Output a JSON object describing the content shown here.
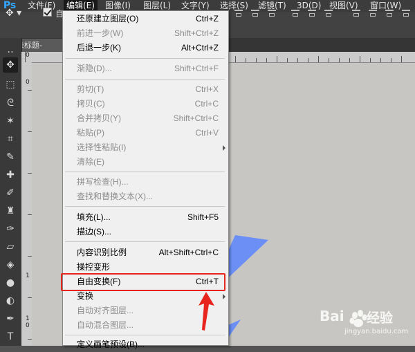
{
  "app": {
    "logo": "Ps"
  },
  "menubar": {
    "items": [
      "文件(F)",
      "编辑(E)",
      "图像(I)",
      "图层(L)",
      "文字(Y)",
      "选择(S)",
      "滤镜(T)",
      "3D(D)",
      "视图(V)",
      "窗口(W)"
    ],
    "active": "编辑(E)"
  },
  "options": {
    "auto_label": "自",
    "move_icon": "move-tool-icon"
  },
  "document": {
    "tab_title": "未标题-"
  },
  "rulers": {
    "top_zero": "0",
    "left_numbers": [
      "0",
      "1",
      "1",
      "0"
    ]
  },
  "edit_menu": {
    "items": [
      {
        "label": "还原建立图层(O)",
        "shortcut": "Ctrl+Z",
        "enabled": true
      },
      {
        "label": "前进一步(W)",
        "shortcut": "Shift+Ctrl+Z",
        "enabled": false
      },
      {
        "label": "后退一步(K)",
        "shortcut": "Alt+Ctrl+Z",
        "enabled": true
      },
      {
        "label": "渐隐(D)...",
        "shortcut": "Shift+Ctrl+F",
        "enabled": false
      },
      {
        "label": "剪切(T)",
        "shortcut": "Ctrl+X",
        "enabled": false
      },
      {
        "label": "拷贝(C)",
        "shortcut": "Ctrl+C",
        "enabled": false
      },
      {
        "label": "合并拷贝(Y)",
        "shortcut": "Shift+Ctrl+C",
        "enabled": false
      },
      {
        "label": "粘贴(P)",
        "shortcut": "Ctrl+V",
        "enabled": false
      },
      {
        "label": "选择性粘贴(I)",
        "shortcut": "",
        "enabled": false,
        "submenu": true
      },
      {
        "label": "清除(E)",
        "shortcut": "",
        "enabled": false
      },
      {
        "label": "拼写检查(H)...",
        "shortcut": "",
        "enabled": false
      },
      {
        "label": "查找和替换文本(X)...",
        "shortcut": "",
        "enabled": false
      },
      {
        "label": "填充(L)...",
        "shortcut": "Shift+F5",
        "enabled": true
      },
      {
        "label": "描边(S)...",
        "shortcut": "",
        "enabled": true
      },
      {
        "label": "内容识别比例",
        "shortcut": "Alt+Shift+Ctrl+C",
        "enabled": true
      },
      {
        "label": "操控变形",
        "shortcut": "",
        "enabled": true
      },
      {
        "label": "自由变换(F)",
        "shortcut": "Ctrl+T",
        "enabled": true,
        "highlighted": true
      },
      {
        "label": "变换",
        "shortcut": "",
        "enabled": true,
        "submenu": true
      },
      {
        "label": "自动对齐图层...",
        "shortcut": "",
        "enabled": false
      },
      {
        "label": "自动混合图层...",
        "shortcut": "",
        "enabled": false
      },
      {
        "label": "定义画笔预设(B)...",
        "shortcut": "",
        "enabled": true
      }
    ]
  },
  "watermark": {
    "brand": "Bai",
    "product": "经验",
    "url": "jingyan.baidu.com"
  },
  "colors": {
    "accent": "#33a7ff",
    "highlight": "#e8241e",
    "shape": "#6b8ff5",
    "canvas": "#c7c6c2"
  }
}
